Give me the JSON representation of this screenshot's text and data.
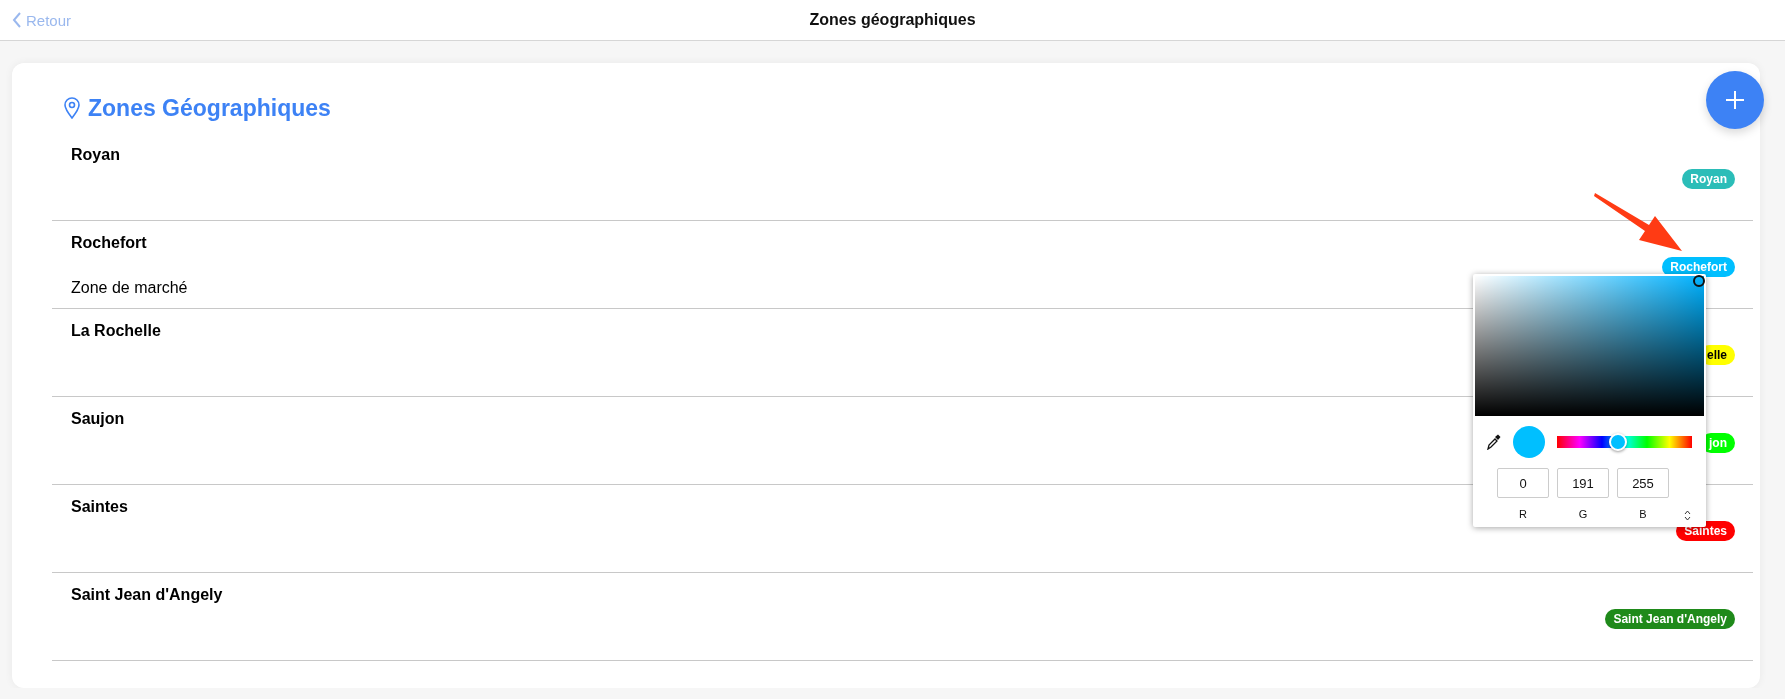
{
  "header": {
    "back_label": "Retour",
    "title": "Zones géographiques"
  },
  "section": {
    "title": "Zones Géographiques"
  },
  "zones": [
    {
      "name": "Royan",
      "badge": "Royan",
      "color": "#2bbdb8"
    },
    {
      "name": "Rochefort",
      "subtitle": "Zone de marché",
      "badge": "Rochefort",
      "color": "#00bfff"
    },
    {
      "name": "La Rochelle",
      "badge": "elle",
      "color": "#ffff00"
    },
    {
      "name": "Saujon",
      "badge": "jon",
      "color": "#00ff00"
    },
    {
      "name": "Saintes",
      "badge": "Saintes",
      "color": "#ff0000"
    },
    {
      "name": "Saint Jean d'Angely",
      "badge": "Saint Jean d'Angely",
      "color": "#1f8a1a"
    }
  ],
  "color_picker": {
    "hue": {
      "level": 0.45
    },
    "channels": [
      {
        "label": "R",
        "value": "0"
      },
      {
        "label": "G",
        "value": "191"
      },
      {
        "label": "B",
        "value": "255"
      }
    ]
  }
}
